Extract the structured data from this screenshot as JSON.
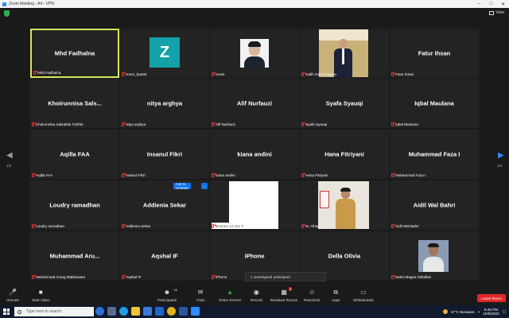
{
  "window": {
    "title": "Zoom Meeting - A4 - VPN"
  },
  "view_label": "View",
  "pages": {
    "left": "1/2",
    "right": "1/2"
  },
  "tiles": [
    {
      "name": "Mhd Fadhalna",
      "tag": "Mhd Fadhalna"
    },
    {
      "name": "",
      "tag": "zoom_baa04",
      "avatar": "Z"
    },
    {
      "name": "",
      "tag": "Kevin"
    },
    {
      "name": "",
      "tag": "Galih indrahutagna"
    },
    {
      "name": "Fatur Ihsan",
      "tag": "Fatur Ihsan"
    },
    {
      "name": "Khoirunnisa Sals...",
      "tag": "Khoirunnisa Salsabila Tuhfah"
    },
    {
      "name": "nitya arghya",
      "tag": "nitya arghya"
    },
    {
      "name": "Alif Nurfauzi",
      "tag": "Alif Nurfauzi"
    },
    {
      "name": "Syafa Syauqi",
      "tag": "Syafa Syauqi"
    },
    {
      "name": "Iqbal Maulana",
      "tag": "Iqbal Maulana"
    },
    {
      "name": "Aqilla FAA",
      "tag": "Aqilla FAA"
    },
    {
      "name": "Insanul Fikri",
      "tag": "insanul Fikri"
    },
    {
      "name": "kiana andini",
      "tag": "kiana andini"
    },
    {
      "name": "Hana Fitriyani",
      "tag": "Hana Fitriyani"
    },
    {
      "name": "Muhammad Faza I",
      "tag": "Muhammad Faza I"
    },
    {
      "name": "Loudry ramadhan",
      "tag": "Loudry ramadhan"
    },
    {
      "name": "Addienia Sekar",
      "tag": "Addienia Sekar"
    },
    {
      "name": "",
      "tag": "Nosrina 14 161 X"
    },
    {
      "name": "",
      "tag": "M. Alham"
    },
    {
      "name": "Aidil Wal Bahri",
      "tag": "Aidil Wal Bahri"
    },
    {
      "name": "Muhammad Aru...",
      "tag": "Muhammad Arung Makkawaru"
    },
    {
      "name": "Aqshal IF",
      "tag": "Aqshal IF"
    },
    {
      "name": "iPhone",
      "tag": "iPhone"
    },
    {
      "name": "Della Olivia",
      "tag": ""
    },
    {
      "name": "",
      "tag": "Satrio Bagus Atthallah"
    }
  ],
  "ask_to_unmute": "Ask to Unmute",
  "ask_more": "...",
  "unassigned": "1 unassigned participant",
  "toolbar": {
    "unmute": "Unmute",
    "start_video": "Start Video",
    "participants": "Participants",
    "participants_count": "45",
    "chat": "Chat",
    "share_screen": "Share Screen",
    "record": "Record",
    "breakout_rooms": "Breakout Rooms",
    "breakout_badge": "1",
    "reactions": "Reactions",
    "apps": "Apps",
    "whiteboards": "Whiteboards",
    "leave": "Leave Room"
  },
  "taskbar": {
    "search_placeholder": "Type here to search",
    "weather": "27°C  Berawan",
    "time": "6:49 PM",
    "date": "10/5/2022"
  },
  "colors": {
    "accent": "#0e71eb",
    "active_border": "#d8e35a",
    "leave": "#e02828",
    "share": "#2db14a"
  }
}
